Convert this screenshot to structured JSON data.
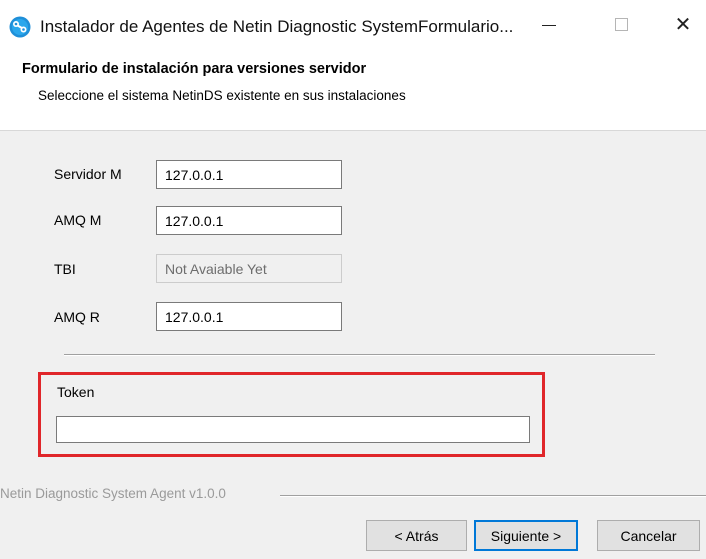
{
  "window": {
    "title": "Instalador de Agentes de Netin Diagnostic SystemFormulario...",
    "icon": "netin-app-icon",
    "controls": {
      "minimize": "minimize-icon",
      "maximize": "maximize-icon",
      "close": "close-icon",
      "close_glyph": "✕"
    }
  },
  "header": {
    "title": "Formulario de instalación para versiones servidor",
    "subtitle": "Seleccione el sistema NetinDS existente en sus instalaciones"
  },
  "form": {
    "fields": [
      {
        "label": "Servidor M",
        "value": "127.0.0.1",
        "enabled": true
      },
      {
        "label": "AMQ M",
        "value": "127.0.0.1",
        "enabled": true
      },
      {
        "label": "TBI",
        "value": "Not Avaiable Yet",
        "enabled": false
      },
      {
        "label": "AMQ R",
        "value": "127.0.0.1",
        "enabled": true
      }
    ],
    "token": {
      "label": "Token",
      "value": "",
      "highlight_color": "#e0262a"
    }
  },
  "footer": {
    "version_text": "Netin Diagnostic System Agent v1.0.0",
    "buttons": {
      "back": "< Atrás",
      "next": "Siguiente >",
      "cancel": "Cancelar"
    }
  },
  "colors": {
    "accent": "#0078d7",
    "window_bg": "#f0f0f0",
    "highlight": "#e0262a"
  }
}
